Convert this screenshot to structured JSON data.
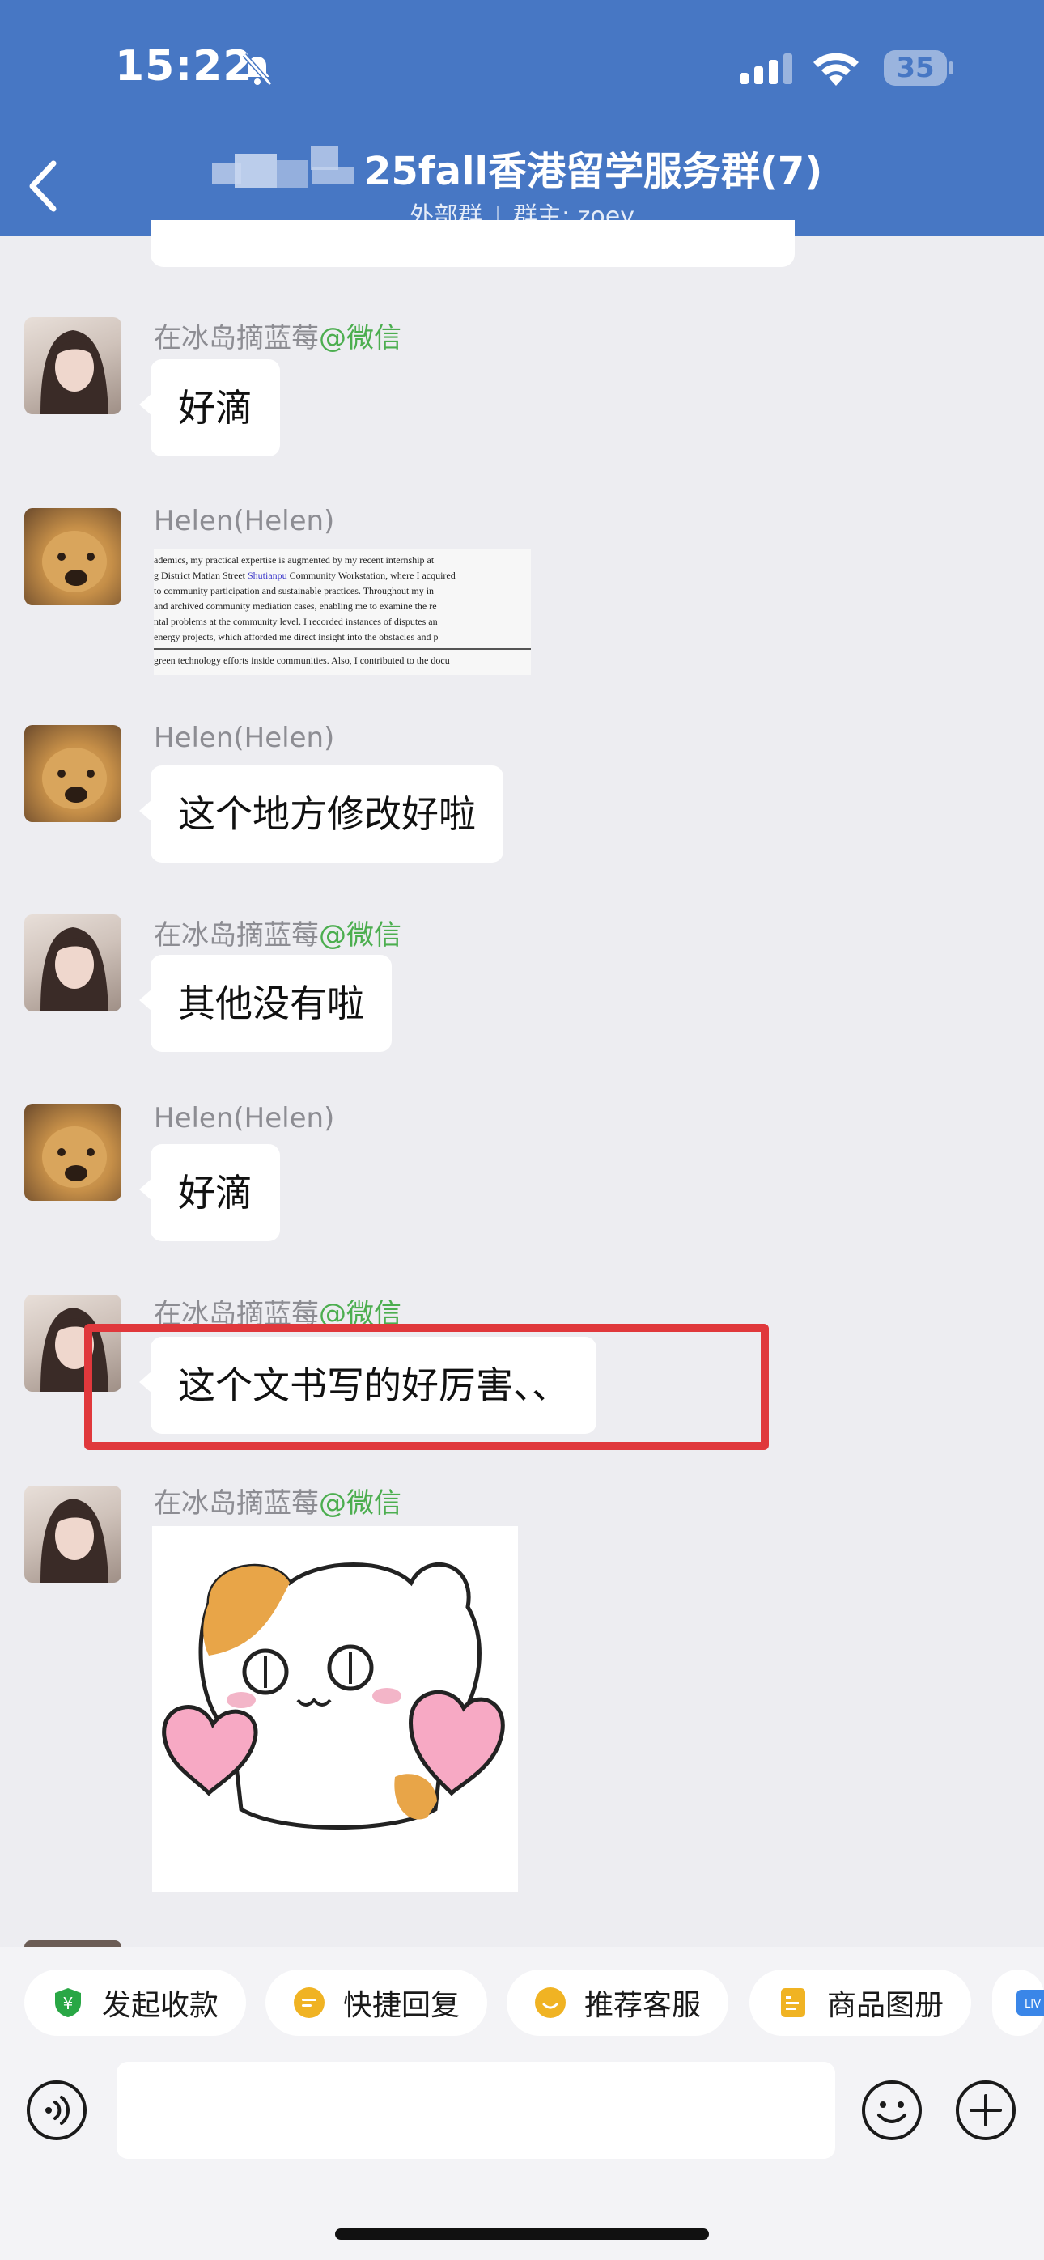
{
  "status_bar": {
    "time": "15:22",
    "battery": "35"
  },
  "header": {
    "title": "25fall香港留学服务群(7)",
    "subtitle_type": "外部群",
    "subtitle_owner": "群主: zoey"
  },
  "messages": [
    {
      "sender": "在冰岛摘蓝莓",
      "tag": "@微信",
      "text": "好滴"
    },
    {
      "sender": "Helen(Helen)",
      "image_lines": [
        "ademics, my practical expertise is augmented by my recent internship at",
        "g District Matian Street Shutianpu Community Workstation, where I acquired",
        "to community participation and sustainable practices. Throughout my in",
        "and archived community mediation cases, enabling me to examine the re",
        "ntal problems at the community level. I recorded instances of disputes an",
        "energy projects, which afforded me direct insight into the obstacles and p",
        "green technology efforts inside communities. Also, I contributed to the docu"
      ],
      "image_highlight": "Shutianpu"
    },
    {
      "sender": "Helen(Helen)",
      "text": "这个地方修改好啦"
    },
    {
      "sender": "在冰岛摘蓝莓",
      "tag": "@微信",
      "text": "其他没有啦"
    },
    {
      "sender": "Helen(Helen)",
      "text": "好滴"
    },
    {
      "sender": "在冰岛摘蓝莓",
      "tag": "@微信",
      "text": "这个文书写的好厉害、、"
    },
    {
      "sender": "在冰岛摘蓝莓",
      "tag": "@微信",
      "sticker": "hamster-hearts-sticker"
    }
  ],
  "quick_actions": [
    {
      "label": "发起收款",
      "icon": "payment-shield-icon",
      "color": "#29a745"
    },
    {
      "label": "快捷回复",
      "icon": "quick-reply-icon",
      "color": "#f0b323"
    },
    {
      "label": "推荐客服",
      "icon": "service-icon",
      "color": "#f0b323"
    },
    {
      "label": "商品图册",
      "icon": "catalog-icon",
      "color": "#f0b323"
    },
    {
      "label": "LIV",
      "icon": "live-icon",
      "color": "#3a86e8"
    }
  ],
  "colors": {
    "header": "#4777c4",
    "highlight_box": "#e0383c",
    "wechat_tag": "#4cae4f"
  }
}
